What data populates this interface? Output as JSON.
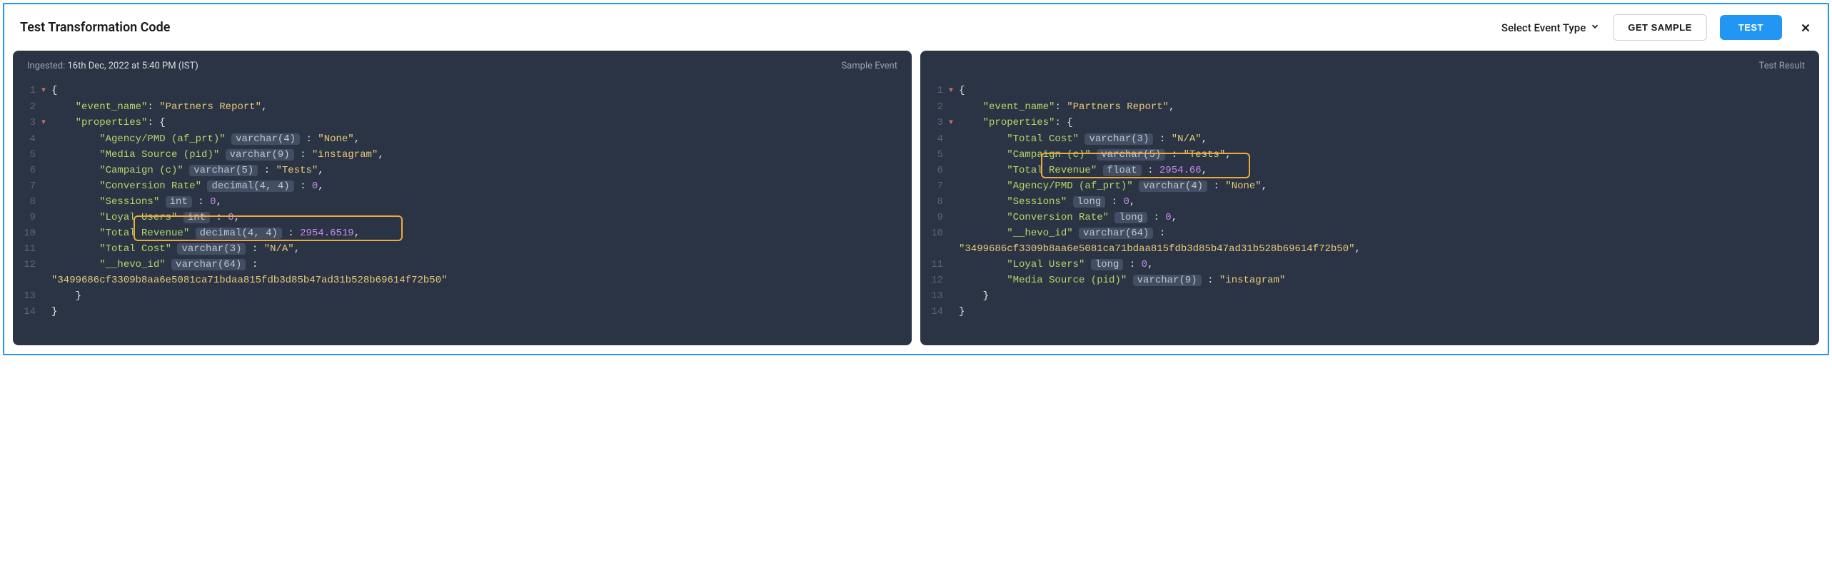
{
  "header": {
    "title": "Test Transformation Code",
    "dropdown_label": "Select Event Type",
    "get_sample_label": "GET SAMPLE",
    "test_label": "TEST"
  },
  "left_pane": {
    "ingested_label": "Ingested: ",
    "ingested_time": "16th Dec, 2022 at 5:40 PM (IST)",
    "tag": "Sample Event",
    "lines": [
      {
        "n": 1,
        "fold": "▼",
        "tokens": [
          {
            "t": "punct",
            "v": "{"
          }
        ]
      },
      {
        "n": 2,
        "indent": 4,
        "tokens": [
          {
            "t": "key",
            "v": "\"event_name\""
          },
          {
            "t": "punct",
            "v": ": "
          },
          {
            "t": "str",
            "v": "\"Partners Report\""
          },
          {
            "t": "punct",
            "v": ","
          }
        ]
      },
      {
        "n": 3,
        "fold": "▼",
        "indent": 4,
        "tokens": [
          {
            "t": "key",
            "v": "\"properties\""
          },
          {
            "t": "punct",
            "v": ": {"
          }
        ]
      },
      {
        "n": 4,
        "indent": 8,
        "tokens": [
          {
            "t": "key",
            "v": "\"Agency/PMD (af_prt)\""
          },
          {
            "t": "punct",
            "v": " "
          },
          {
            "t": "type",
            "v": "varchar(4)"
          },
          {
            "t": "punct",
            "v": " : "
          },
          {
            "t": "str",
            "v": "\"None\""
          },
          {
            "t": "punct",
            "v": ","
          }
        ]
      },
      {
        "n": 5,
        "indent": 8,
        "tokens": [
          {
            "t": "key",
            "v": "\"Media Source (pid)\""
          },
          {
            "t": "punct",
            "v": " "
          },
          {
            "t": "type",
            "v": "varchar(9)"
          },
          {
            "t": "punct",
            "v": " : "
          },
          {
            "t": "str",
            "v": "\"instagram\""
          },
          {
            "t": "punct",
            "v": ","
          }
        ]
      },
      {
        "n": 6,
        "indent": 8,
        "tokens": [
          {
            "t": "key",
            "v": "\"Campaign (c)\""
          },
          {
            "t": "punct",
            "v": " "
          },
          {
            "t": "type",
            "v": "varchar(5)"
          },
          {
            "t": "punct",
            "v": " : "
          },
          {
            "t": "str",
            "v": "\"Tests\""
          },
          {
            "t": "punct",
            "v": ","
          }
        ]
      },
      {
        "n": 7,
        "indent": 8,
        "tokens": [
          {
            "t": "key",
            "v": "\"Conversion Rate\""
          },
          {
            "t": "punct",
            "v": " "
          },
          {
            "t": "type",
            "v": "decimal(4, 4)"
          },
          {
            "t": "punct",
            "v": " : "
          },
          {
            "t": "num",
            "v": "0"
          },
          {
            "t": "punct",
            "v": ","
          }
        ]
      },
      {
        "n": 8,
        "indent": 8,
        "tokens": [
          {
            "t": "key",
            "v": "\"Sessions\""
          },
          {
            "t": "punct",
            "v": " "
          },
          {
            "t": "type",
            "v": "int"
          },
          {
            "t": "punct",
            "v": " : "
          },
          {
            "t": "num",
            "v": "0"
          },
          {
            "t": "punct",
            "v": ","
          }
        ]
      },
      {
        "n": 9,
        "indent": 8,
        "tokens": [
          {
            "t": "key",
            "v": "\"Loyal Users\""
          },
          {
            "t": "punct",
            "v": " "
          },
          {
            "t": "type",
            "v": "int"
          },
          {
            "t": "punct",
            "v": " : "
          },
          {
            "t": "num",
            "v": "0"
          },
          {
            "t": "punct",
            "v": ","
          }
        ]
      },
      {
        "n": 10,
        "indent": 8,
        "highlight": true,
        "tokens": [
          {
            "t": "key",
            "v": "\"Total Revenue\""
          },
          {
            "t": "punct",
            "v": " "
          },
          {
            "t": "type",
            "v": "decimal(4, 4)"
          },
          {
            "t": "punct",
            "v": " : "
          },
          {
            "t": "num",
            "v": "2954.6519"
          },
          {
            "t": "punct",
            "v": ","
          }
        ]
      },
      {
        "n": 11,
        "indent": 8,
        "tokens": [
          {
            "t": "key",
            "v": "\"Total Cost\""
          },
          {
            "t": "punct",
            "v": " "
          },
          {
            "t": "type",
            "v": "varchar(3)"
          },
          {
            "t": "punct",
            "v": " : "
          },
          {
            "t": "str",
            "v": "\"N/A\""
          },
          {
            "t": "punct",
            "v": ","
          }
        ]
      },
      {
        "n": 12,
        "indent": 8,
        "tokens": [
          {
            "t": "key",
            "v": "\"__hevo_id\""
          },
          {
            "t": "punct",
            "v": " "
          },
          {
            "t": "type",
            "v": "varchar(64)"
          },
          {
            "t": "punct",
            "v": " :"
          }
        ]
      },
      {
        "n": "",
        "indent": 0,
        "tokens": [
          {
            "t": "str",
            "v": "\"3499686cf3309b8aa6e5081ca71bdaa815fdb3d85b47ad31b528b69614f72b50\""
          }
        ]
      },
      {
        "n": 13,
        "indent": 4,
        "tokens": [
          {
            "t": "punct",
            "v": "}"
          }
        ]
      },
      {
        "n": 14,
        "indent": 0,
        "tokens": [
          {
            "t": "punct",
            "v": "}"
          }
        ]
      }
    ]
  },
  "right_pane": {
    "tag": "Test Result",
    "lines": [
      {
        "n": 1,
        "fold": "▼",
        "tokens": [
          {
            "t": "punct",
            "v": "{"
          }
        ]
      },
      {
        "n": 2,
        "indent": 4,
        "tokens": [
          {
            "t": "key",
            "v": "\"event_name\""
          },
          {
            "t": "punct",
            "v": ": "
          },
          {
            "t": "str",
            "v": "\"Partners Report\""
          },
          {
            "t": "punct",
            "v": ","
          }
        ]
      },
      {
        "n": 3,
        "fold": "▼",
        "indent": 4,
        "tokens": [
          {
            "t": "key",
            "v": "\"properties\""
          },
          {
            "t": "punct",
            "v": ": {"
          }
        ]
      },
      {
        "n": 4,
        "indent": 8,
        "tokens": [
          {
            "t": "key",
            "v": "\"Total Cost\""
          },
          {
            "t": "punct",
            "v": " "
          },
          {
            "t": "type",
            "v": "varchar(3)"
          },
          {
            "t": "punct",
            "v": " : "
          },
          {
            "t": "str",
            "v": "\"N/A\""
          },
          {
            "t": "punct",
            "v": ","
          }
        ]
      },
      {
        "n": 5,
        "indent": 8,
        "tokens": [
          {
            "t": "key",
            "v": "\"Campaign (c)\""
          },
          {
            "t": "punct",
            "v": " "
          },
          {
            "t": "type",
            "v": "varchar(5)"
          },
          {
            "t": "punct",
            "v": " : "
          },
          {
            "t": "str",
            "v": "\"Tests\""
          },
          {
            "t": "punct",
            "v": ","
          }
        ]
      },
      {
        "n": 6,
        "indent": 8,
        "highlight": true,
        "tokens": [
          {
            "t": "key",
            "v": "\"Total Revenue\""
          },
          {
            "t": "punct",
            "v": " "
          },
          {
            "t": "type",
            "v": "float"
          },
          {
            "t": "punct",
            "v": " : "
          },
          {
            "t": "num",
            "v": "2954.66"
          },
          {
            "t": "punct",
            "v": ","
          }
        ]
      },
      {
        "n": 7,
        "indent": 8,
        "tokens": [
          {
            "t": "key",
            "v": "\"Agency/PMD (af_prt)\""
          },
          {
            "t": "punct",
            "v": " "
          },
          {
            "t": "type",
            "v": "varchar(4)"
          },
          {
            "t": "punct",
            "v": " : "
          },
          {
            "t": "str",
            "v": "\"None\""
          },
          {
            "t": "punct",
            "v": ","
          }
        ]
      },
      {
        "n": 8,
        "indent": 8,
        "tokens": [
          {
            "t": "key",
            "v": "\"Sessions\""
          },
          {
            "t": "punct",
            "v": " "
          },
          {
            "t": "type",
            "v": "long"
          },
          {
            "t": "punct",
            "v": " : "
          },
          {
            "t": "num",
            "v": "0"
          },
          {
            "t": "punct",
            "v": ","
          }
        ]
      },
      {
        "n": 9,
        "indent": 8,
        "tokens": [
          {
            "t": "key",
            "v": "\"Conversion Rate\""
          },
          {
            "t": "punct",
            "v": " "
          },
          {
            "t": "type",
            "v": "long"
          },
          {
            "t": "punct",
            "v": " : "
          },
          {
            "t": "num",
            "v": "0"
          },
          {
            "t": "punct",
            "v": ","
          }
        ]
      },
      {
        "n": 10,
        "indent": 8,
        "tokens": [
          {
            "t": "key",
            "v": "\"__hevo_id\""
          },
          {
            "t": "punct",
            "v": " "
          },
          {
            "t": "type",
            "v": "varchar(64)"
          },
          {
            "t": "punct",
            "v": " :"
          }
        ]
      },
      {
        "n": "",
        "indent": 0,
        "tokens": [
          {
            "t": "str",
            "v": "\"3499686cf3309b8aa6e5081ca71bdaa815fdb3d85b47ad31b528b69614f72b50\""
          },
          {
            "t": "punct",
            "v": ","
          }
        ]
      },
      {
        "n": 11,
        "indent": 8,
        "tokens": [
          {
            "t": "key",
            "v": "\"Loyal Users\""
          },
          {
            "t": "punct",
            "v": " "
          },
          {
            "t": "type",
            "v": "long"
          },
          {
            "t": "punct",
            "v": " : "
          },
          {
            "t": "num",
            "v": "0"
          },
          {
            "t": "punct",
            "v": ","
          }
        ]
      },
      {
        "n": 12,
        "indent": 8,
        "tokens": [
          {
            "t": "key",
            "v": "\"Media Source (pid)\""
          },
          {
            "t": "punct",
            "v": " "
          },
          {
            "t": "type",
            "v": "varchar(9)"
          },
          {
            "t": "punct",
            "v": " : "
          },
          {
            "t": "str",
            "v": "\"instagram\""
          }
        ]
      },
      {
        "n": 13,
        "indent": 4,
        "tokens": [
          {
            "t": "punct",
            "v": "}"
          }
        ]
      },
      {
        "n": 14,
        "indent": 0,
        "tokens": [
          {
            "t": "punct",
            "v": "}"
          }
        ]
      }
    ]
  }
}
